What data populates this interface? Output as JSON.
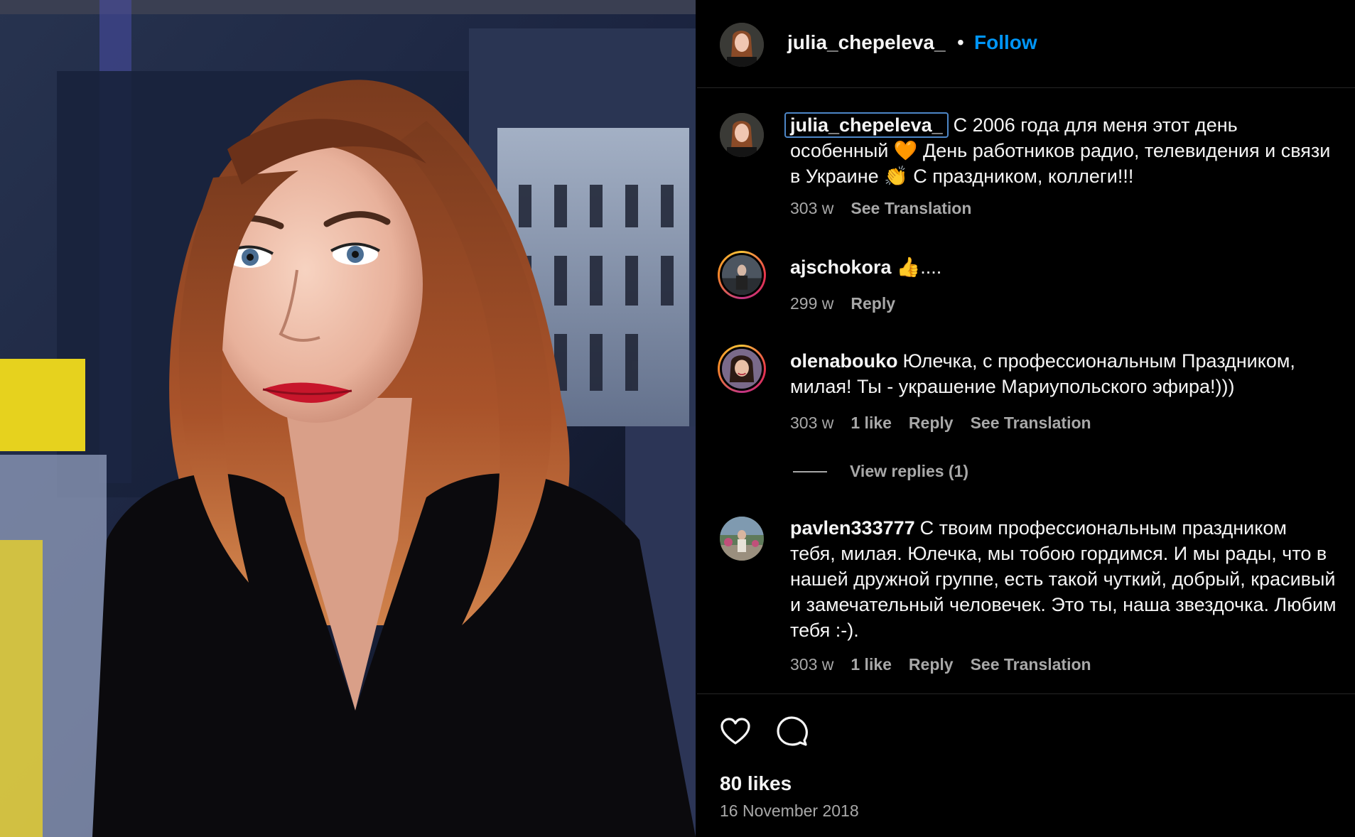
{
  "post": {
    "username": "julia_chepeleva_",
    "separator": "•",
    "follow_label": "Follow",
    "likes": "80 likes",
    "date": "16 November 2018",
    "photo_icon": "selfie-portrait-image"
  },
  "caption": {
    "username": "julia_chepeleva_",
    "text": "С 2006 года для меня этот день особенный 🧡 День работников радио, телевидения и связи в Украине 👏 С праздником, коллеги!!!",
    "time": "303 w",
    "translate": "See Translation"
  },
  "comments": [
    {
      "username": "ajschokora",
      "text": "👍....",
      "time": "299 w",
      "reply": "Reply"
    },
    {
      "username": "olenabouko",
      "text": "Юлечка, с профессиональным Праздником, милая! Ты - украшение Мариупольского эфира!)))",
      "time": "303 w",
      "likes": "1 like",
      "reply": "Reply",
      "translate": "See Translation"
    },
    {
      "username": "pavlen333777",
      "text": "С твоим профессиональным праздником тебя, милая. Юлечка, мы тобою гордимся. И мы рады, что в нашей дружной группе, есть такой чуткий, добрый, красивый и замечательный человечек. Это ты, наша звездочка. Любим тебя :-).",
      "time": "303 w",
      "likes": "1 like",
      "reply": "Reply",
      "translate": "See Translation"
    }
  ],
  "view_replies": "View replies (1)",
  "icons": {
    "like": "heart-icon",
    "comment": "speech-bubble-icon"
  },
  "colors": {
    "background": "#000000",
    "text": "#f5f5f5",
    "secondary": "#a8a8a8",
    "link": "#0095f6",
    "divider": "#262626"
  }
}
